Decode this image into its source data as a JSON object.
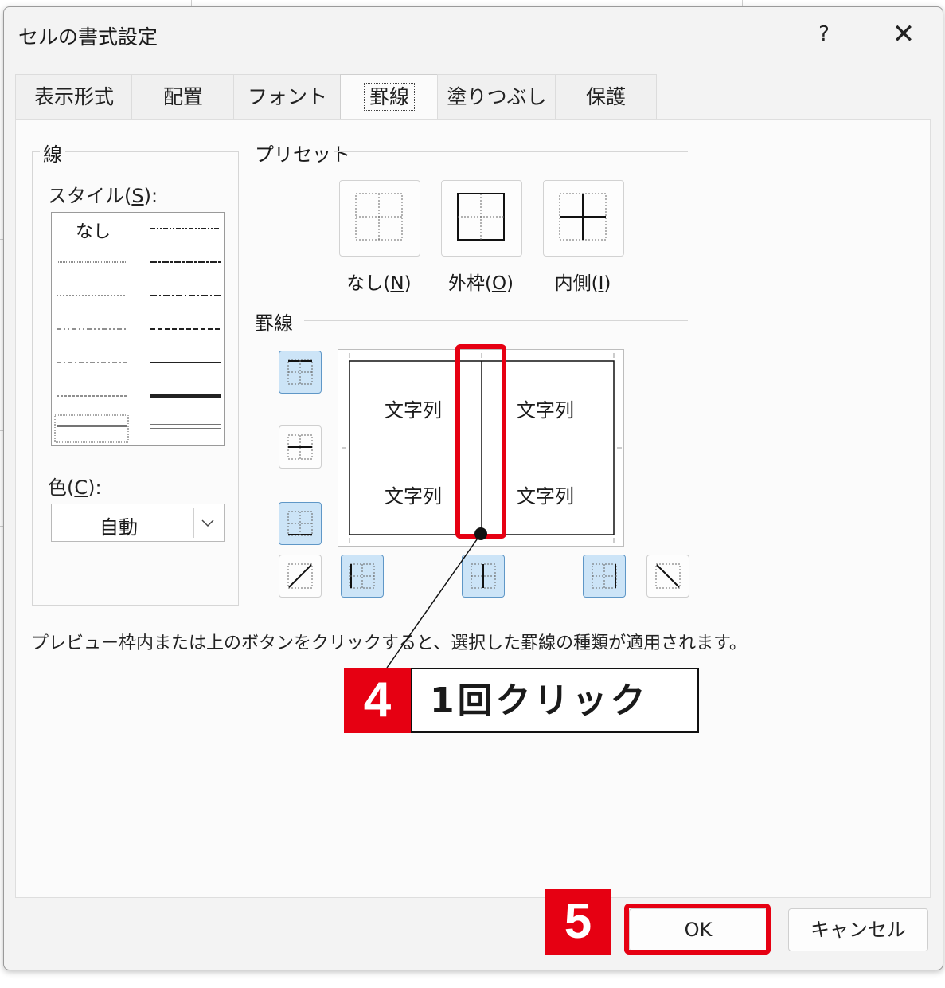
{
  "dialog": {
    "title": "セルの書式設定",
    "help": "?",
    "close": "✕"
  },
  "tabs": [
    {
      "label": "表示形式"
    },
    {
      "label": "配置"
    },
    {
      "label": "フォント"
    },
    {
      "label": "罫線",
      "active": true
    },
    {
      "label": "塗りつぶし"
    },
    {
      "label": "保護"
    }
  ],
  "line_group": {
    "title": "線",
    "style_label": "スタイル(",
    "style_key": "S",
    "style_suffix": "):",
    "none_option": "なし",
    "color_label": "色(",
    "color_key": "C",
    "color_suffix": "):",
    "color_value": "自動"
  },
  "preset_group": {
    "title": "プリセット",
    "buttons": [
      {
        "label": "なし(",
        "key": "N",
        "suffix": ")"
      },
      {
        "label": "外枠(",
        "key": "O",
        "suffix": ")"
      },
      {
        "label": "内側(",
        "key": "I",
        "suffix": ")"
      }
    ]
  },
  "border_group": {
    "title": "罫線",
    "preview_text": [
      "文字列",
      "文字列",
      "文字列",
      "文字列"
    ]
  },
  "hint": "プレビュー枠内または上のボタンをクリックすると、選択した罫線の種類が適用されます。",
  "buttons": {
    "ok": "OK",
    "cancel": "キャンセル"
  },
  "annotations": {
    "step4_number": "4",
    "step4_text": "1回クリック",
    "step5_number": "5",
    "color": "#e60012"
  }
}
